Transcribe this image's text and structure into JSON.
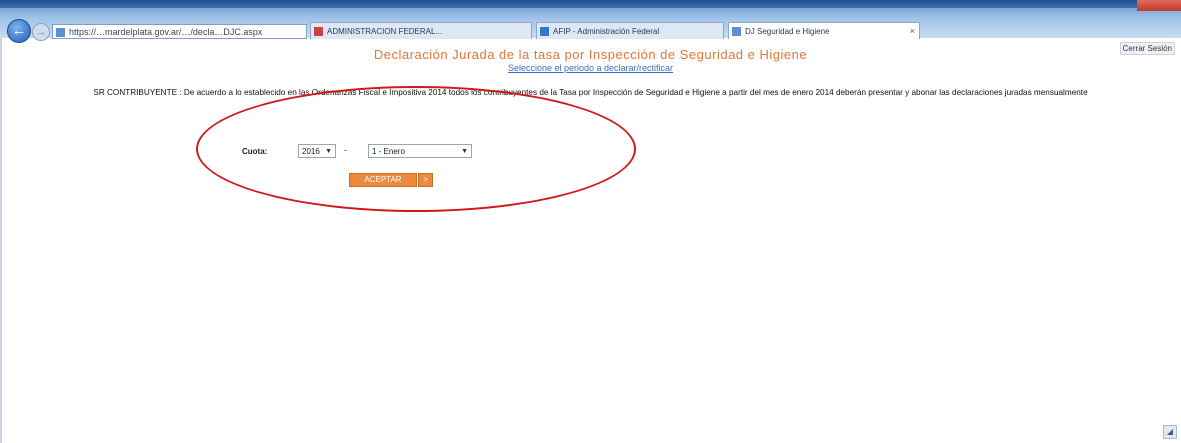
{
  "browser": {
    "address_url": "https://…mardelplata.gov.ar/…/decla…DJC.aspx",
    "tabs": [
      {
        "label": "ADMINISTRACION FEDERAL..."
      },
      {
        "label": "AFIP - Administración Federal"
      },
      {
        "label": "DJ Seguridad e Higiene"
      }
    ]
  },
  "page": {
    "close_session": "Cerrar Sesión",
    "title": "Declaración Jurada de la tasa por Inspección de Seguridad e Higiene",
    "subtitle_link": "Seleccione el periodo a declarar/rectificar",
    "notice": "SR CONTRIBUYENTE : De acuerdo a lo establecido en las Ordenanzas Fiscal e Impositiva 2014 todos los contribuyentes de la Tasa por Inspección de Seguridad e Higiene a partir del mes de enero 2014 deberán presentar y abonar las declaraciones juradas mensualmente"
  },
  "form": {
    "cuota_label": "Cuota:",
    "year_value": "2016",
    "separator": "-",
    "month_value": "1 - Enero",
    "submit_label": "ACEPTAR",
    "submit_arrow": ">"
  },
  "annotation": {
    "color": "#d01818"
  },
  "colors": {
    "title": "#e07838",
    "link": "#3a6fc0",
    "button": "#e98a3e"
  }
}
